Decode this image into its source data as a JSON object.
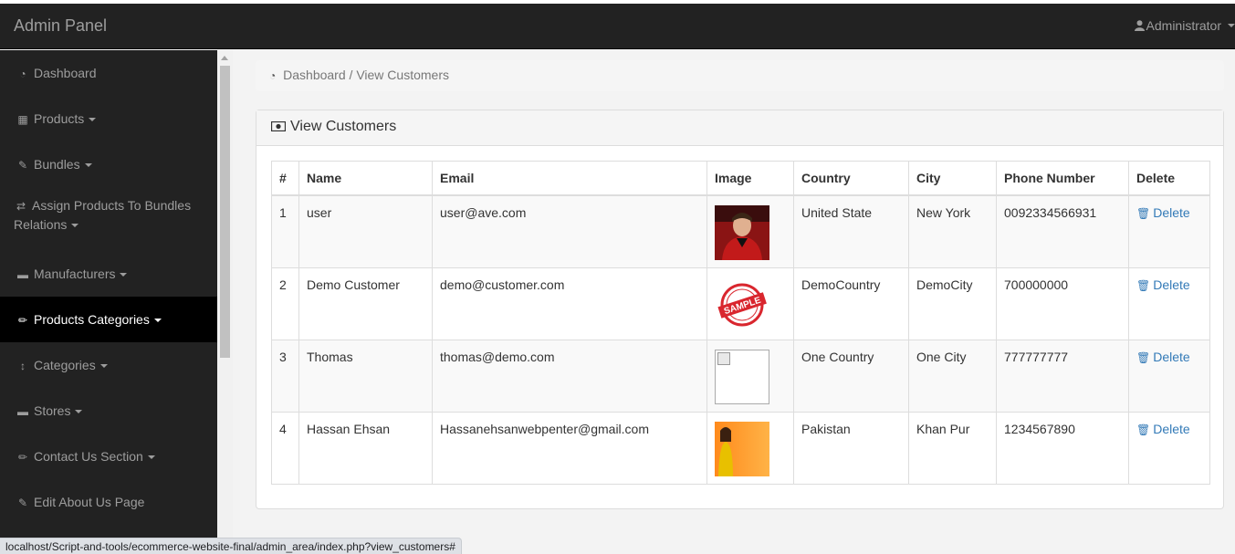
{
  "navbar": {
    "brand": "Admin Panel",
    "user_label": "Administrator",
    "user_icon": "user-icon"
  },
  "sidebar": {
    "items": [
      {
        "label": "Dashboard",
        "icon": "dashboard-icon",
        "dropdown": false
      },
      {
        "label": "Products",
        "icon": "table-icon",
        "dropdown": true
      },
      {
        "label": "Bundles",
        "icon": "edit-icon",
        "dropdown": true
      },
      {
        "label": "Assign Products To Bundles Relations",
        "icon": "retweet-icon",
        "dropdown": true
      },
      {
        "label": "Manufacturers",
        "icon": "briefcase-icon",
        "dropdown": true
      },
      {
        "label": "Products Categories",
        "icon": "pencil-icon",
        "dropdown": true,
        "active": true
      },
      {
        "label": "Categories",
        "icon": "arrows-v-icon",
        "dropdown": true
      },
      {
        "label": "Stores",
        "icon": "briefcase-icon",
        "dropdown": true
      },
      {
        "label": "Contact Us Section",
        "icon": "pencil-icon",
        "dropdown": true
      },
      {
        "label": "Edit About Us Page",
        "icon": "edit-icon",
        "dropdown": false
      }
    ]
  },
  "breadcrumb": {
    "home": "Dashboard",
    "separator": "/",
    "current": "View Customers"
  },
  "panel": {
    "title": "View Customers",
    "icon": "money-icon"
  },
  "table": {
    "headers": [
      "#",
      "Name",
      "Email",
      "Image",
      "Country",
      "City",
      "Phone Number",
      "Delete"
    ],
    "rows": [
      {
        "num": "1",
        "name": "user",
        "email": "user@ave.com",
        "image": "photo-red-jacket",
        "country": "United State",
        "city": "New York",
        "phone": "0092334566931",
        "delete": "Delete"
      },
      {
        "num": "2",
        "name": "Demo Customer",
        "email": "demo@customer.com",
        "image": "sample-stamp",
        "country": "DemoCountry",
        "city": "DemoCity",
        "phone": "700000000",
        "delete": "Delete"
      },
      {
        "num": "3",
        "name": "Thomas",
        "email": "thomas@demo.com",
        "image": "broken-image",
        "country": "One Country",
        "city": "One City",
        "phone": "777777777",
        "delete": "Delete"
      },
      {
        "num": "4",
        "name": "Hassan Ehsan",
        "email": "Hassanehsanwebpenter@gmail.com",
        "image": "photo-orange",
        "country": "Pakistan",
        "city": "Khan Pur",
        "phone": "1234567890",
        "delete": "Delete"
      }
    ]
  },
  "stamp_text": "SAMPLE",
  "statusbar": {
    "url": "localhost/Script-and-tools/ecommerce-website-final/admin_area/index.php?view_customers#"
  },
  "colors": {
    "navbar": "#222222",
    "active_item": "#000000",
    "link": "#337ab7",
    "stamp": "#d9262e"
  }
}
